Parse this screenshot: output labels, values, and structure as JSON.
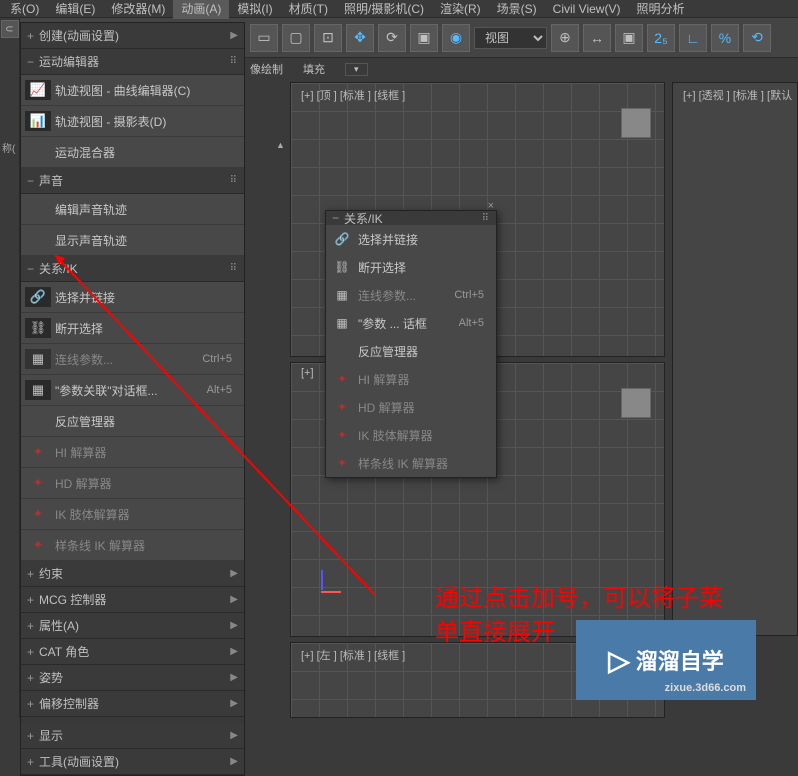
{
  "menubar": {
    "items": [
      {
        "label": "系(O)"
      },
      {
        "label": "编辑(E)"
      },
      {
        "label": "修改器(M)"
      },
      {
        "label": "动画(A)",
        "active": true
      },
      {
        "label": "模拟(I)"
      },
      {
        "label": "材质(T)"
      },
      {
        "label": "照明/摄影机(C)"
      },
      {
        "label": "渲染(R)"
      },
      {
        "label": "场景(S)"
      },
      {
        "label": "Civil View(V)"
      },
      {
        "label": "照明分析"
      }
    ]
  },
  "toolbar": {
    "view_label": "视图"
  },
  "secondary": {
    "item1": "像绘制",
    "item2": "填充"
  },
  "sidebar": {
    "sections": {
      "create": {
        "toggle": "+",
        "label": "创建(动画设置)"
      },
      "motion_editor": {
        "toggle": "−",
        "label": "运动编辑器"
      },
      "sound": {
        "toggle": "−",
        "label": "声音"
      },
      "ik": {
        "toggle": "−",
        "label": "关系/IK"
      },
      "constraint": {
        "toggle": "+",
        "label": "约束"
      },
      "mcg": {
        "toggle": "+",
        "label": "MCG 控制器"
      },
      "attr": {
        "toggle": "+",
        "label": "属性(A)"
      },
      "cat": {
        "toggle": "+",
        "label": "CAT 角色"
      },
      "pose": {
        "toggle": "+",
        "label": "姿势"
      },
      "offset": {
        "toggle": "+",
        "label": "偏移控制器"
      },
      "display": {
        "toggle": "+",
        "label": "显示"
      },
      "tools": {
        "toggle": "+",
        "label": "工具(动画设置)"
      }
    },
    "motion_items": [
      {
        "label": "轨迹视图 - 曲线编辑器(C)"
      },
      {
        "label": "轨迹视图 - 摄影表(D)"
      },
      {
        "label": "运动混合器"
      }
    ],
    "sound_items": [
      {
        "label": "编辑声音轨迹"
      },
      {
        "label": "显示声音轨迹"
      }
    ],
    "ik_items": [
      {
        "label": "选择并链接"
      },
      {
        "label": "断开选择"
      },
      {
        "label": "连线参数...",
        "shortcut": "Ctrl+5",
        "dim": true
      },
      {
        "label": "\"参数关联\"对话框...",
        "shortcut": "Alt+5"
      },
      {
        "label": "反应管理器"
      },
      {
        "label": "HI 解算器",
        "dim": true
      },
      {
        "label": "HD 解算器",
        "dim": true
      },
      {
        "label": "IK 肢体解算器",
        "dim": true
      },
      {
        "label": "样条线 IK 解算器",
        "dim": true
      }
    ]
  },
  "popup": {
    "title": "关系/IK",
    "toggle": "−",
    "items": [
      {
        "label": "选择并链接"
      },
      {
        "label": "断开选择"
      },
      {
        "label": "连线参数...",
        "shortcut": "Ctrl+5",
        "dim": true
      },
      {
        "label": "\"参数 ... 话框",
        "shortcut": "Alt+5"
      },
      {
        "label": "反应管理器"
      },
      {
        "label": "HI 解算器",
        "dim": true
      },
      {
        "label": "HD 解算器",
        "dim": true
      },
      {
        "label": "IK 肢体解算器",
        "dim": true
      },
      {
        "label": "样条线 IK 解算器",
        "dim": true
      }
    ]
  },
  "viewports": {
    "top": "[+] [顶 ] [标准 ] [线框 ]",
    "persp": "[+] [透视 ] [标准 ] [默认",
    "left": "[+] [左 ] [标准 ] [线框 ]"
  },
  "annotation": {
    "line1": "通过点击加号，可以将子菜",
    "line2": "单直接展开"
  },
  "watermark": {
    "text": "溜溜自学",
    "url": "zixue.3d66.com"
  },
  "left_strip": {
    "label": "称("
  }
}
